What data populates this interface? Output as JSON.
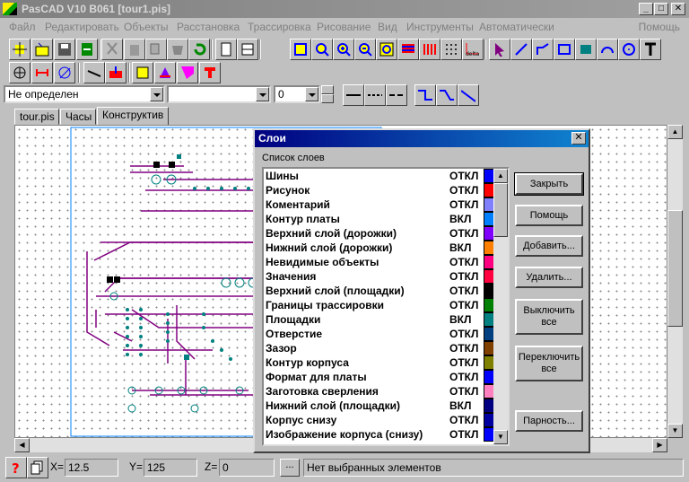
{
  "app": {
    "title": "PasCAD V10 B061 [tour1.pis]",
    "min": "_",
    "max": "□",
    "close": "✕"
  },
  "menu": [
    {
      "label": "Файл"
    },
    {
      "label": "Редактировать"
    },
    {
      "label": "Объекты"
    },
    {
      "label": "Расстановка"
    },
    {
      "label": "Трассировка"
    },
    {
      "label": "Рисование"
    },
    {
      "label": "Вид"
    },
    {
      "label": "Инструменты"
    },
    {
      "label": "Автоматически"
    }
  ],
  "menu_help": "Помощь",
  "toolbar": {
    "delta_label": "delta",
    "layer_combo": "Не определен",
    "second_combo": "",
    "width_combo": "0"
  },
  "tabs": [
    {
      "label": "tour.pis"
    },
    {
      "label": "Часы"
    },
    {
      "label": "Конструктив"
    }
  ],
  "status": {
    "x_label": "X=",
    "x_value": "12.5",
    "y_label": "Y=",
    "y_value": "125",
    "z_label": "Z=",
    "z_value": "0",
    "dots": "...",
    "message": "Нет выбранных элементов"
  },
  "dialog": {
    "title": "Слои",
    "close": "✕",
    "list_caption": "Список слоев",
    "layers": [
      {
        "name": "Шины",
        "state": "ОТКЛ",
        "color": "#0000ff"
      },
      {
        "name": "Рисунок",
        "state": "ОТКЛ",
        "color": "#ff0000"
      },
      {
        "name": "Коментарий",
        "state": "ОТКЛ",
        "color": "#8080ff"
      },
      {
        "name": "Контур платы",
        "state": "ВКЛ",
        "color": "#0080ff"
      },
      {
        "name": "Верхний слой (дорожки)",
        "state": "ОТКЛ",
        "color": "#8000ff"
      },
      {
        "name": "Нижний слой (дорожки)",
        "state": "ВКЛ",
        "color": "#ff8000"
      },
      {
        "name": "Невидимые объекты",
        "state": "ОТКЛ",
        "color": "#ff0080"
      },
      {
        "name": "Значения",
        "state": "ОТКЛ",
        "color": "#ff0040"
      },
      {
        "name": "Верхний слой (площадки)",
        "state": "ОТКЛ",
        "color": "#000000"
      },
      {
        "name": "Границы трассировки",
        "state": "ОТКЛ",
        "color": "#008000"
      },
      {
        "name": "Площадки",
        "state": "ВКЛ",
        "color": "#008080"
      },
      {
        "name": "Отверстие",
        "state": "ОТКЛ",
        "color": "#004080"
      },
      {
        "name": "Зазор",
        "state": "ОТКЛ",
        "color": "#804000"
      },
      {
        "name": "Контур корпуса",
        "state": "ОТКЛ",
        "color": "#808000"
      },
      {
        "name": "Формат для платы",
        "state": "ОТКЛ",
        "color": "#0000ff"
      },
      {
        "name": "Заготовка сверления",
        "state": "ОТКЛ",
        "color": "#ff80c0"
      },
      {
        "name": "Нижний слой (площадки)",
        "state": "ВКЛ",
        "color": "#000080"
      },
      {
        "name": "Корпус снизу",
        "state": "ОТКЛ",
        "color": "#0000a0"
      },
      {
        "name": "Изображение корпуса (снизу)",
        "state": "ОТКЛ",
        "color": "#0000ff"
      }
    ],
    "buttons": {
      "close": "Закрыть",
      "help": "Помощь",
      "add": "Добавить...",
      "delete": "Удалить...",
      "disable_all": "Выключить все",
      "toggle_all": "Переключить все",
      "parity": "Парность..."
    }
  }
}
